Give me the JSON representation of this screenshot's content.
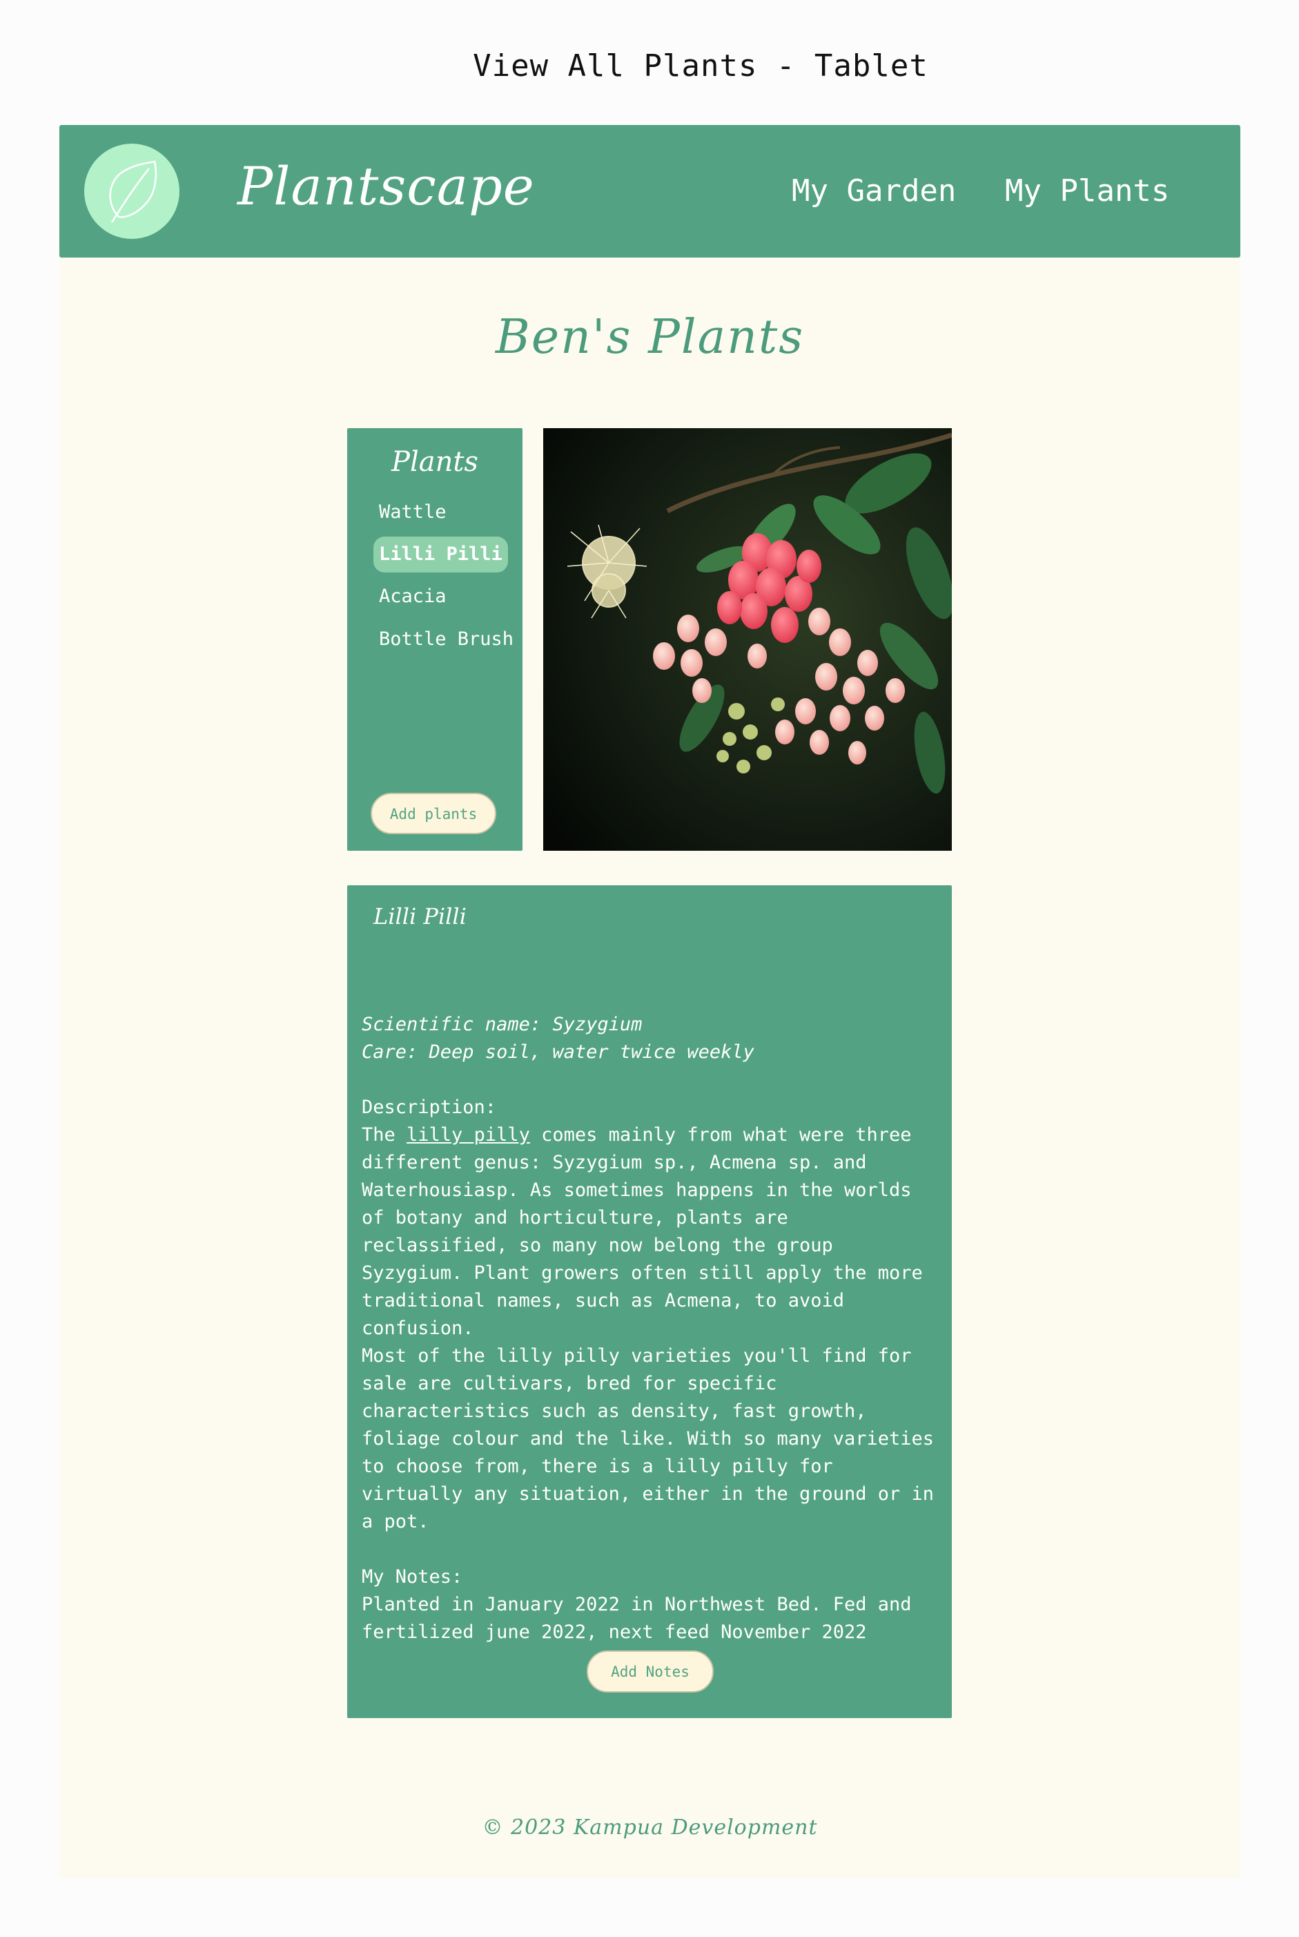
{
  "frame_title": "View All Plants - Tablet",
  "header": {
    "brand": "Plantscape",
    "nav": [
      "My Garden",
      "My Plants"
    ]
  },
  "page_title": "Ben's Plants",
  "sidebar": {
    "title": "Plants",
    "items": [
      {
        "label": "Wattle",
        "active": false
      },
      {
        "label": "Lilli Pilli",
        "active": true
      },
      {
        "label": "Acacia",
        "active": false
      },
      {
        "label": "Bottle Brush",
        "active": false
      }
    ],
    "add_button": "Add plants"
  },
  "details": {
    "title": "Lilli Pilli",
    "scientific_name": "Scientific name: Syzygium",
    "care": "Care: Deep soil, water twice weekly",
    "description_label": "Description:",
    "description_prefix": "The ",
    "description_link": "lilly pilly",
    "description_rest": " comes mainly from what were three different genus: Syzygium sp., Acmena sp. and Waterhousiasp. As sometimes happens in the worlds of botany and horticulture, plants are reclassified, so many now belong the group Syzygium. Plant growers often still apply the more traditional names, such as Acmena, to avoid confusion.",
    "description_p2": "Most of the lilly pilly varieties you'll find for sale are cultivars, bred for specific characteristics such as density, fast growth, foliage colour and the like. With so many varieties to choose from, there is a lilly pilly for virtually any situation, either in the ground or in a pot.",
    "notes_label": "My Notes:",
    "notes_text": "Planted in January 2022 in Northwest Bed. Fed and fertilized june 2022, next feed November 2022",
    "add_notes_button": "Add Notes"
  },
  "footer": "© 2023 Kampua Development",
  "colors": {
    "primary": "#52a283",
    "background": "#fdfbef",
    "logo_circle": "#b3f2c9",
    "active_item": "#8ed0a9",
    "button_bg": "#fdf6dc"
  },
  "icons": {
    "logo": "leaf-icon"
  }
}
